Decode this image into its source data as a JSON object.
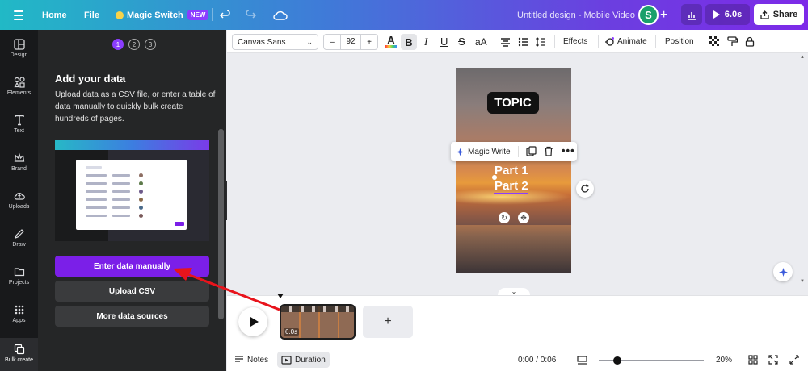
{
  "topbar": {
    "home": "Home",
    "file": "File",
    "magic_switch": "Magic Switch",
    "new_badge": "NEW",
    "doc_title": "Untitled design - Mobile Video",
    "avatar_initial": "S",
    "play_duration": "6.0s",
    "share": "Share"
  },
  "rail": [
    {
      "label": "Design",
      "icon": "layout-icon"
    },
    {
      "label": "Elements",
      "icon": "shapes-icon"
    },
    {
      "label": "Text",
      "icon": "text-icon"
    },
    {
      "label": "Brand",
      "icon": "crown-icon"
    },
    {
      "label": "Uploads",
      "icon": "cloud-upload-icon"
    },
    {
      "label": "Draw",
      "icon": "pen-icon"
    },
    {
      "label": "Projects",
      "icon": "folder-icon"
    },
    {
      "label": "Apps",
      "icon": "grid-dots-icon"
    },
    {
      "label": "Bulk create",
      "icon": "bulk-create-icon"
    }
  ],
  "panel": {
    "steps": [
      "1",
      "2",
      "3"
    ],
    "title": "Add your data",
    "description": "Upload data as a CSV file, or enter a table of data manually to quickly bulk create hundreds of pages.",
    "enter_manually": "Enter data manually",
    "upload_csv": "Upload CSV",
    "more_sources": "More data sources"
  },
  "toolbar": {
    "font": "Canvas Sans",
    "minus": "–",
    "size": "92",
    "plus": "+",
    "text_color_letter": "A",
    "bold": "B",
    "italic": "I",
    "underline": "U",
    "strike": "S",
    "case": "aA",
    "effects": "Effects",
    "animate": "Animate",
    "position": "Position"
  },
  "canvas": {
    "topic": "TOPIC",
    "part1": "Part 1",
    "part2": "Part 2",
    "magic_write": "Magic Write"
  },
  "timeline": {
    "clip_duration": "6.0s",
    "add": "+"
  },
  "footer": {
    "notes": "Notes",
    "duration": "Duration",
    "time": "0:00 / 0:06",
    "zoom": "20%"
  },
  "colors": {
    "accent": "#7b1fe8",
    "arrow": "#e8141c"
  }
}
